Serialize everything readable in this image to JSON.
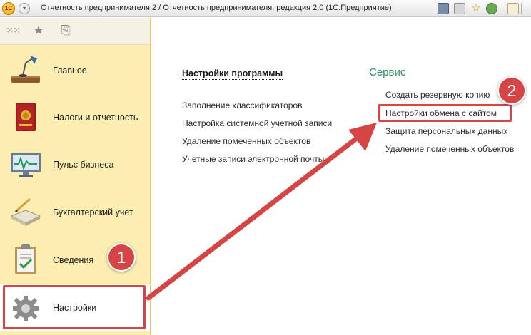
{
  "window": {
    "title": "Отчетность предпринимателя 2 / Отчетность предпринимателя, редакция 2.0   (1С:Предприятие)",
    "logo_text": "1С"
  },
  "sidebar": {
    "items": [
      {
        "label": "Главное",
        "icon": "desk-lamp-icon"
      },
      {
        "label": "Налоги и отчетность",
        "icon": "tax-book-icon"
      },
      {
        "label": "Пульс бизнеса",
        "icon": "monitor-chart-icon"
      },
      {
        "label": "Бухгалтерский учет",
        "icon": "ledger-pen-icon"
      },
      {
        "label": "Сведения",
        "icon": "clipboard-check-icon"
      },
      {
        "label": "Настройки",
        "icon": "gear-icon"
      }
    ]
  },
  "main": {
    "program_settings": {
      "title": "Настройки программы",
      "links": [
        "Заполнение классификаторов",
        "Настройка системной учетной записи",
        "Удаление помеченных объектов",
        "Учетные записи электронной почты"
      ]
    },
    "service": {
      "title": "Сервис",
      "links": [
        "Создать резервную копию",
        "Настройки обмена с сайтом",
        "Защита персональных данных",
        "Удаление помеченных объектов"
      ]
    }
  },
  "annotations": {
    "badge_1": "1",
    "badge_2": "2",
    "color": "#d64545"
  },
  "colors": {
    "sidebar_bg": "#fbeeb0",
    "service_title": "#2d8f5e"
  }
}
